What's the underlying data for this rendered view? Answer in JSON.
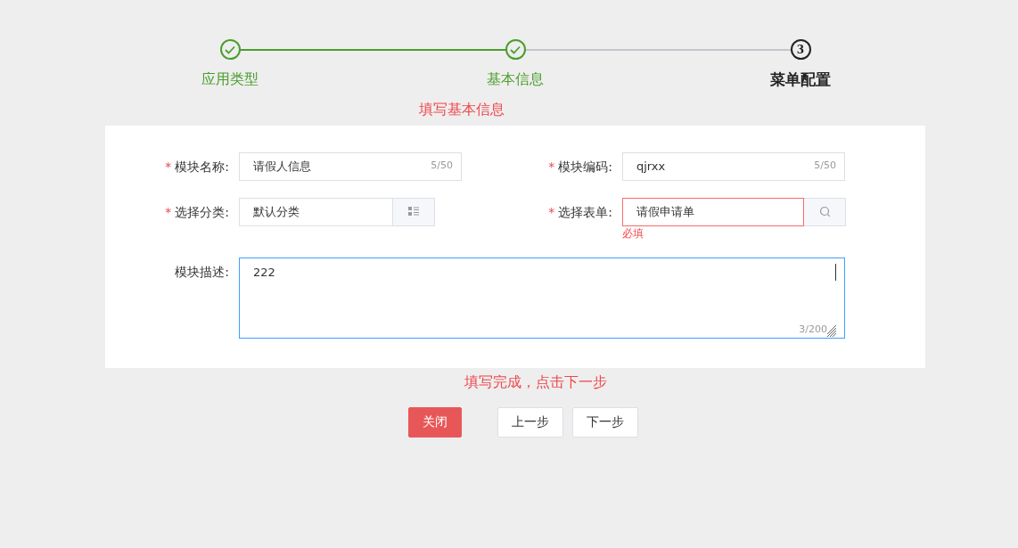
{
  "steps": [
    {
      "label": "应用类型",
      "completed": true
    },
    {
      "label": "基本信息",
      "completed": true
    },
    {
      "label": "菜单配置",
      "completed": false,
      "number": "3"
    }
  ],
  "hint_top": "填写基本信息",
  "fields": [
    {
      "kind": "text",
      "label": "模块名称:",
      "required_mark": "*",
      "value": "请假人信息",
      "counter": "5/50"
    },
    {
      "kind": "text",
      "label": "模块编码:",
      "required_mark": "*",
      "value": "qjrxx",
      "counter": "5/50"
    },
    {
      "kind": "select",
      "label": "选择分类:",
      "required_mark": "*",
      "value": "默认分类"
    },
    {
      "kind": "lookup",
      "label": "选择表单:",
      "required_mark": "*",
      "value": "请假申请单",
      "error": "必填"
    },
    {
      "kind": "textarea",
      "label": "模块描述:",
      "value": "222",
      "counter": "3/200",
      "focused": true
    }
  ],
  "hint_bottom": "填写完成，点击下一步",
  "buttons": [
    {
      "label": "关闭",
      "kind": "danger"
    },
    {
      "label": "上一步",
      "kind": "default"
    },
    {
      "label": "下一步",
      "kind": "default"
    }
  ]
}
